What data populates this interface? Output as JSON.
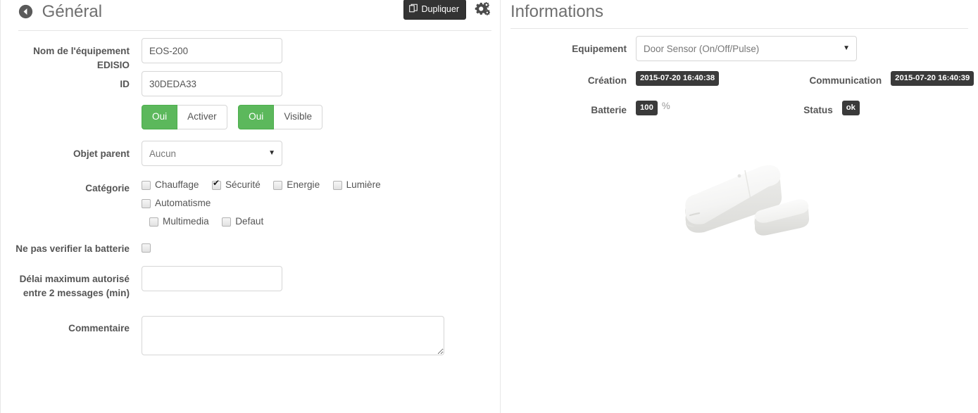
{
  "left_panel": {
    "title": "Général",
    "back_icon": "arrow-circle-left-icon",
    "duplicate_button": "Dupliquer",
    "duplicate_icon": "copy-icon",
    "settings_icon": "cogs-icon",
    "fields": {
      "name_label": "Nom de l'équipement EDISIO",
      "name_value": "EOS-200",
      "id_label": "ID",
      "id_value": "30DEDA33",
      "parent_label": "Objet parent",
      "parent_value": "Aucun",
      "category_label": "Catégorie",
      "nocheck_battery_label": "Ne pas verifier la batterie",
      "delay_label": "Délai maximum autorisé entre 2 messages (min)",
      "delay_value": "",
      "comment_label": "Commentaire",
      "comment_value": ""
    },
    "toggles": [
      {
        "on_label": "Oui",
        "off_label": "Activer",
        "state": "on"
      },
      {
        "on_label": "Oui",
        "off_label": "Visible",
        "state": "on"
      }
    ],
    "categories": [
      {
        "label": "Chauffage",
        "checked": false
      },
      {
        "label": "Sécurité",
        "checked": true
      },
      {
        "label": "Energie",
        "checked": false
      },
      {
        "label": "Lumière",
        "checked": false
      },
      {
        "label": "Automatisme",
        "checked": false
      },
      {
        "label": "Multimedia",
        "checked": false
      },
      {
        "label": "Defaut",
        "checked": false
      }
    ],
    "nocheck_battery_checked": false
  },
  "right_panel": {
    "title": "Informations",
    "equipment_label": "Equipement",
    "equipment_value": "Door Sensor (On/Off/Pulse)",
    "creation_label": "Création",
    "creation_value": "2015-07-20 16:40:38",
    "communication_label": "Communication",
    "communication_value": "2015-07-20 16:40:39",
    "battery_label": "Batterie",
    "battery_value": "100",
    "battery_unit": "%",
    "status_label": "Status",
    "status_value": "ok",
    "product_image": "door-sensor-photo"
  },
  "colors": {
    "toggle_on": "#5cb85c",
    "badge_dark": "#3a3a3a",
    "button_dark": "#333333",
    "label_text": "#555555",
    "legend_text": "#6f6f6f",
    "border": "#d6d6d6"
  }
}
